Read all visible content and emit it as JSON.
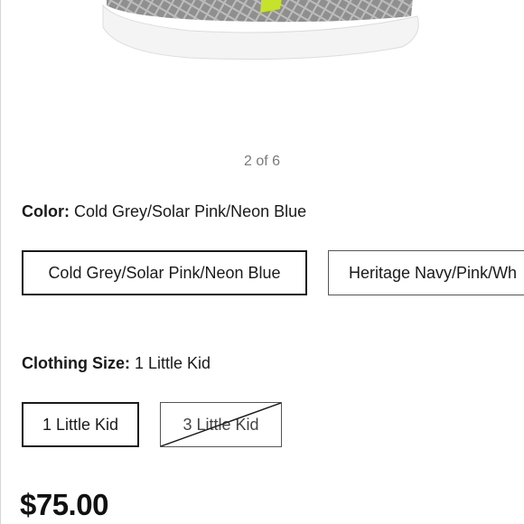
{
  "gallery": {
    "counter": "2 of 6"
  },
  "color": {
    "label": "Color:",
    "selected_value": "Cold Grey/Solar Pink/Neon Blue",
    "options": [
      {
        "label": "Cold Grey/Solar Pink/Neon Blue",
        "selected": true
      },
      {
        "label": "Heritage Navy/Pink/Wh",
        "selected": false
      }
    ]
  },
  "size": {
    "label": "Clothing Size:",
    "selected_value": "1 Little Kid",
    "options": [
      {
        "label": "1 Little Kid",
        "selected": true,
        "available": true
      },
      {
        "label": "3 Little Kid",
        "selected": false,
        "available": false
      }
    ]
  },
  "price": "$75.00",
  "colors": {
    "text": "#1a1a1a",
    "muted": "#7a7a7a",
    "shoe_grey": "#8c8c8c"
  }
}
